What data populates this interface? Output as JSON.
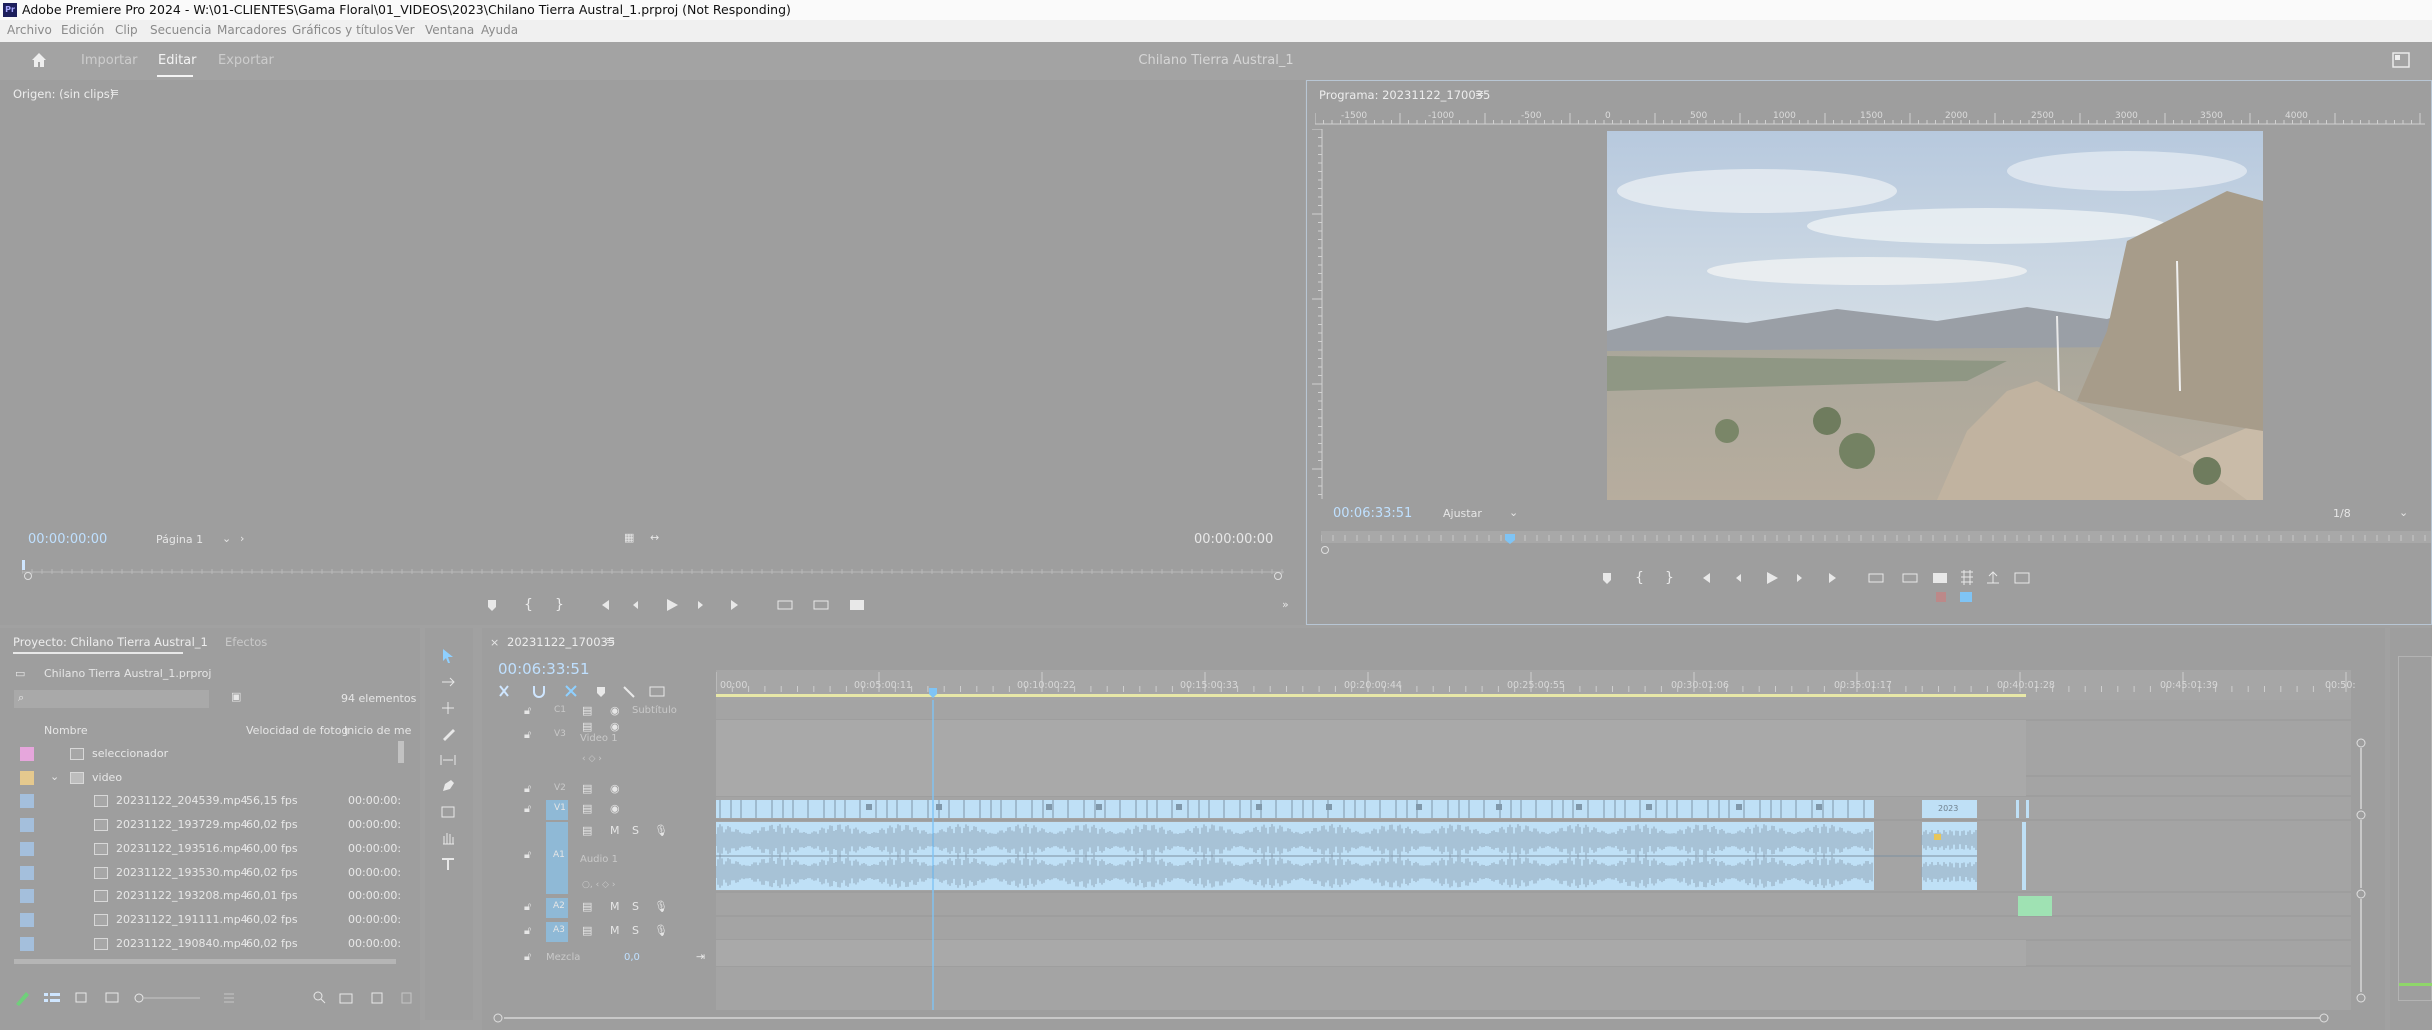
{
  "window": {
    "title": "Adobe Premiere Pro 2024 - W:\\01-CLIENTES\\Gama Floral\\01_VIDEOS\\2023\\Chilano Tierra Austral_1.prproj (Not Responding)",
    "logo_text": "Pr"
  },
  "menu": [
    "Archivo",
    "Edición",
    "Clip",
    "Secuencia",
    "Marcadores",
    "Gráficos y títulos",
    "Ver",
    "Ventana",
    "Ayuda"
  ],
  "workspace": {
    "tabs": [
      "Importar",
      "Editar",
      "Exportar"
    ],
    "active_tab": "Editar",
    "project_title": "Chilano Tierra Austral_1"
  },
  "source_monitor": {
    "title": "Origen: (sin clips)",
    "timecode_in": "00:00:00:00",
    "page_select": "Página 1",
    "timecode_out": "00:00:00:00"
  },
  "program_monitor": {
    "title": "Programa: 20231122_170035",
    "timecode": "00:06:33:51",
    "fit_select": "Ajustar",
    "resolution_select": "1/8",
    "ruler_labels": [
      "-1500",
      "-1000",
      "-500",
      "0",
      "500",
      "1000",
      "1500",
      "2000",
      "2500",
      "3000",
      "3500",
      "4000"
    ]
  },
  "project_panel": {
    "tab_project": "Proyecto: Chilano Tierra Austral_1",
    "tab_effects": "Efectos",
    "project_file": "Chilano Tierra Austral_1.prproj",
    "item_count": "94 elementos",
    "columns": {
      "name": "Nombre",
      "fps": "Velocidad de fotog",
      "start": "Inicio de me"
    },
    "rows": [
      {
        "name": "seleccionador",
        "fps": "",
        "start": "",
        "color": "#e6a6dc",
        "kind": "bin"
      },
      {
        "name": "video",
        "fps": "",
        "start": "",
        "color": "#e5c98e",
        "kind": "folder"
      },
      {
        "name": "20231122_204539.mp4",
        "fps": "56,15 fps",
        "start": "00:00:00:",
        "color": "#a4bfdc",
        "kind": "clip"
      },
      {
        "name": "20231122_193729.mp4",
        "fps": "60,02 fps",
        "start": "00:00:00:",
        "color": "#a4bfdc",
        "kind": "clip"
      },
      {
        "name": "20231122_193516.mp4",
        "fps": "60,00 fps",
        "start": "00:00:00:",
        "color": "#a4bfdc",
        "kind": "clip"
      },
      {
        "name": "20231122_193530.mp4",
        "fps": "60,02 fps",
        "start": "00:00:00:",
        "color": "#a4bfdc",
        "kind": "clip"
      },
      {
        "name": "20231122_193208.mp4",
        "fps": "60,01 fps",
        "start": "00:00:00:",
        "color": "#a4bfdc",
        "kind": "clip"
      },
      {
        "name": "20231122_191111.mp4",
        "fps": "60,02 fps",
        "start": "00:00:00:",
        "color": "#a4bfdc",
        "kind": "clip"
      },
      {
        "name": "20231122_190840.mp4",
        "fps": "60,02 fps",
        "start": "00:00:00:",
        "color": "#a4bfdc",
        "kind": "clip"
      }
    ]
  },
  "timeline": {
    "sequence_tab": "20231122_170035",
    "timecode": "00:06:33:51",
    "ruler": [
      "00:00",
      "00:05:00:11",
      "00:10:00:22",
      "00:15:00:33",
      "00:20:00:44",
      "00:25:00:55",
      "00:30:01:06",
      "00:35:01:17",
      "00:40:01:28",
      "00:45:01:39",
      "00:50:"
    ],
    "tracks": {
      "c1": "C1",
      "c1_name": "Subtítulo",
      "v3": "V3",
      "v3_name": "Video 1",
      "v2": "V2",
      "v1": "V1",
      "a1": "A1",
      "a1_name": "Audio 1",
      "a2": "A2",
      "a3": "A3",
      "mix": "Mezcla",
      "mix_value": "0,0"
    },
    "clip_label": "2023",
    "accent_color": "#bfe0f6"
  }
}
